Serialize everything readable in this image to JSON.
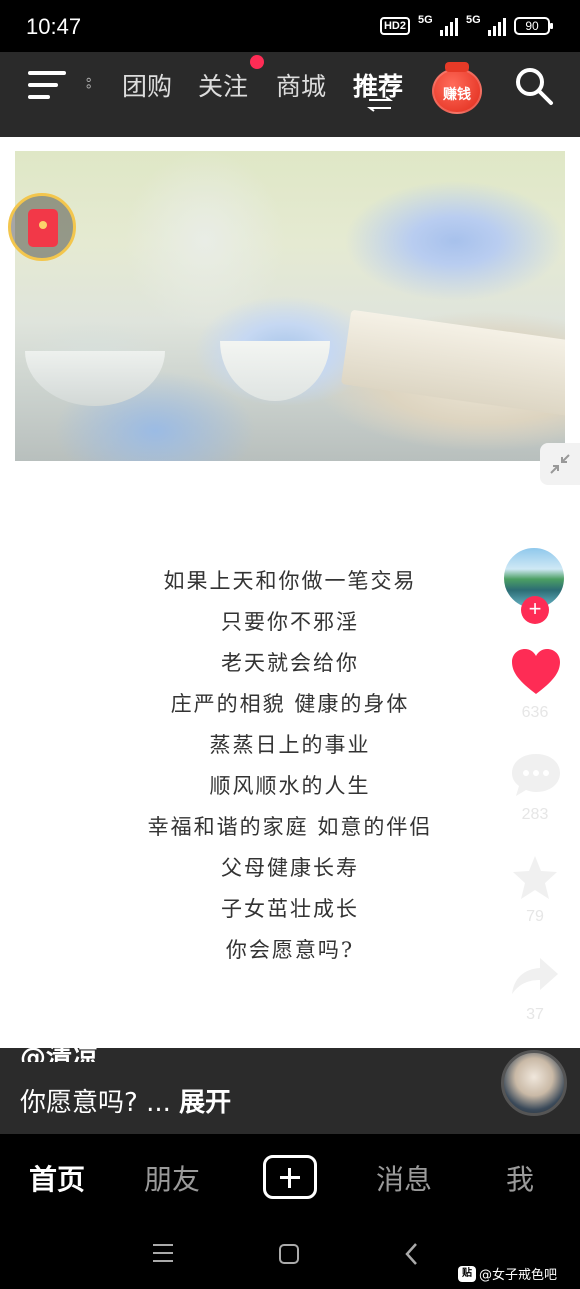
{
  "status_bar": {
    "time": "10:47",
    "hd_label": "HD2",
    "signal1_label": "5G",
    "signal2_label": "5G",
    "battery": "90"
  },
  "top_nav": {
    "tabs": [
      {
        "label": "团购",
        "active": false
      },
      {
        "label": "关注",
        "active": false,
        "has_dot": true
      },
      {
        "label": "商城",
        "active": false
      },
      {
        "label": "推荐",
        "active": true
      }
    ],
    "earn_label": "赚钱",
    "icons": [
      "menu-icon",
      "swap-icon",
      "search-icon"
    ]
  },
  "video": {
    "poem_lines": [
      "如果上天和你做一笔交易",
      "只要你不邪淫",
      "老天就会给你",
      "庄严的相貌 健康的身体",
      "蒸蒸日上的事业",
      "顺风顺水的人生",
      "幸福和谐的家庭 如意的伴侣",
      "父母健康长寿",
      "子女茁壮成长",
      "你会愿意吗?"
    ],
    "author": "@清凉",
    "description": "你愿意吗? ...",
    "expand_label": "展开"
  },
  "actions": {
    "follow_plus": "+",
    "likes": "636",
    "comments": "283",
    "favorites": "79",
    "shares": "37",
    "like_color": "#fe2c55"
  },
  "bottom_nav": {
    "items": [
      {
        "label": "首页",
        "active": true
      },
      {
        "label": "朋友",
        "active": false
      },
      {
        "label": "消息",
        "active": false
      },
      {
        "label": "我",
        "active": false
      }
    ]
  },
  "watermark": {
    "logo": "贴",
    "text": "@女子戒色吧"
  }
}
